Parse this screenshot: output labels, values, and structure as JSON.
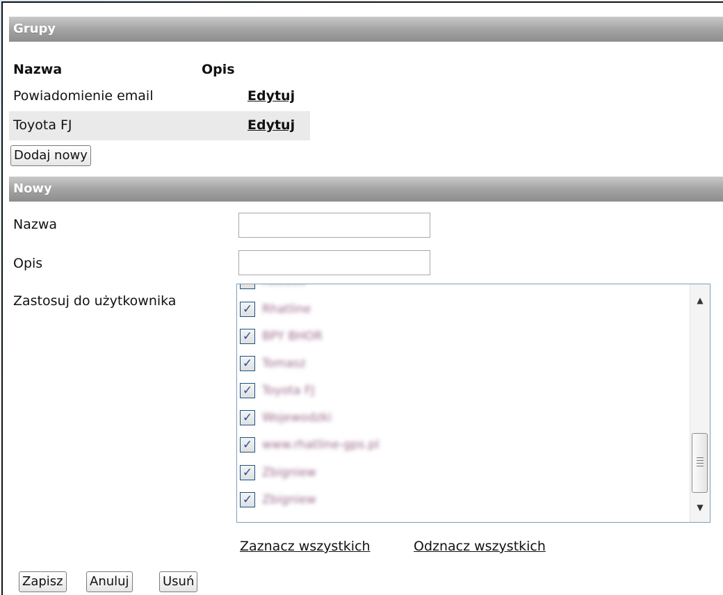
{
  "groups": {
    "header": "Grupy",
    "col_name": "Nazwa",
    "col_desc": "Opis",
    "rows": [
      {
        "name": "Powiadomienie email",
        "action": "Edytuj"
      },
      {
        "name": "Toyota FJ",
        "action": "Edytuj"
      }
    ],
    "add_button": "Dodaj nowy"
  },
  "new_form": {
    "header": "Nowy",
    "name_label": "Nazwa",
    "name_value": "",
    "desc_label": "Opis",
    "desc_value": "",
    "apply_label": "Zastosuj do użytkownika",
    "users": [
      {
        "checked": true,
        "name": "Rhatline"
      },
      {
        "checked": true,
        "name": "BPY BHOR"
      },
      {
        "checked": true,
        "name": "Tomasz"
      },
      {
        "checked": true,
        "name": "Toyota FJ"
      },
      {
        "checked": true,
        "name": "Wojewodzki"
      },
      {
        "checked": true,
        "name": "www.rhatline-gps.pl"
      },
      {
        "checked": true,
        "name": "Zbigniew"
      },
      {
        "checked": true,
        "name": "Zbigniew"
      }
    ],
    "select_all": "Zaznacz wszystkich",
    "deselect_all": "Odznacz wszystkich",
    "buttons": {
      "save": "Zapisz",
      "cancel": "Anuluj",
      "delete": "Usuń"
    }
  },
  "icons": {
    "checkbox_mark": "✓",
    "scroll_up": "▲",
    "scroll_down": "▼"
  }
}
